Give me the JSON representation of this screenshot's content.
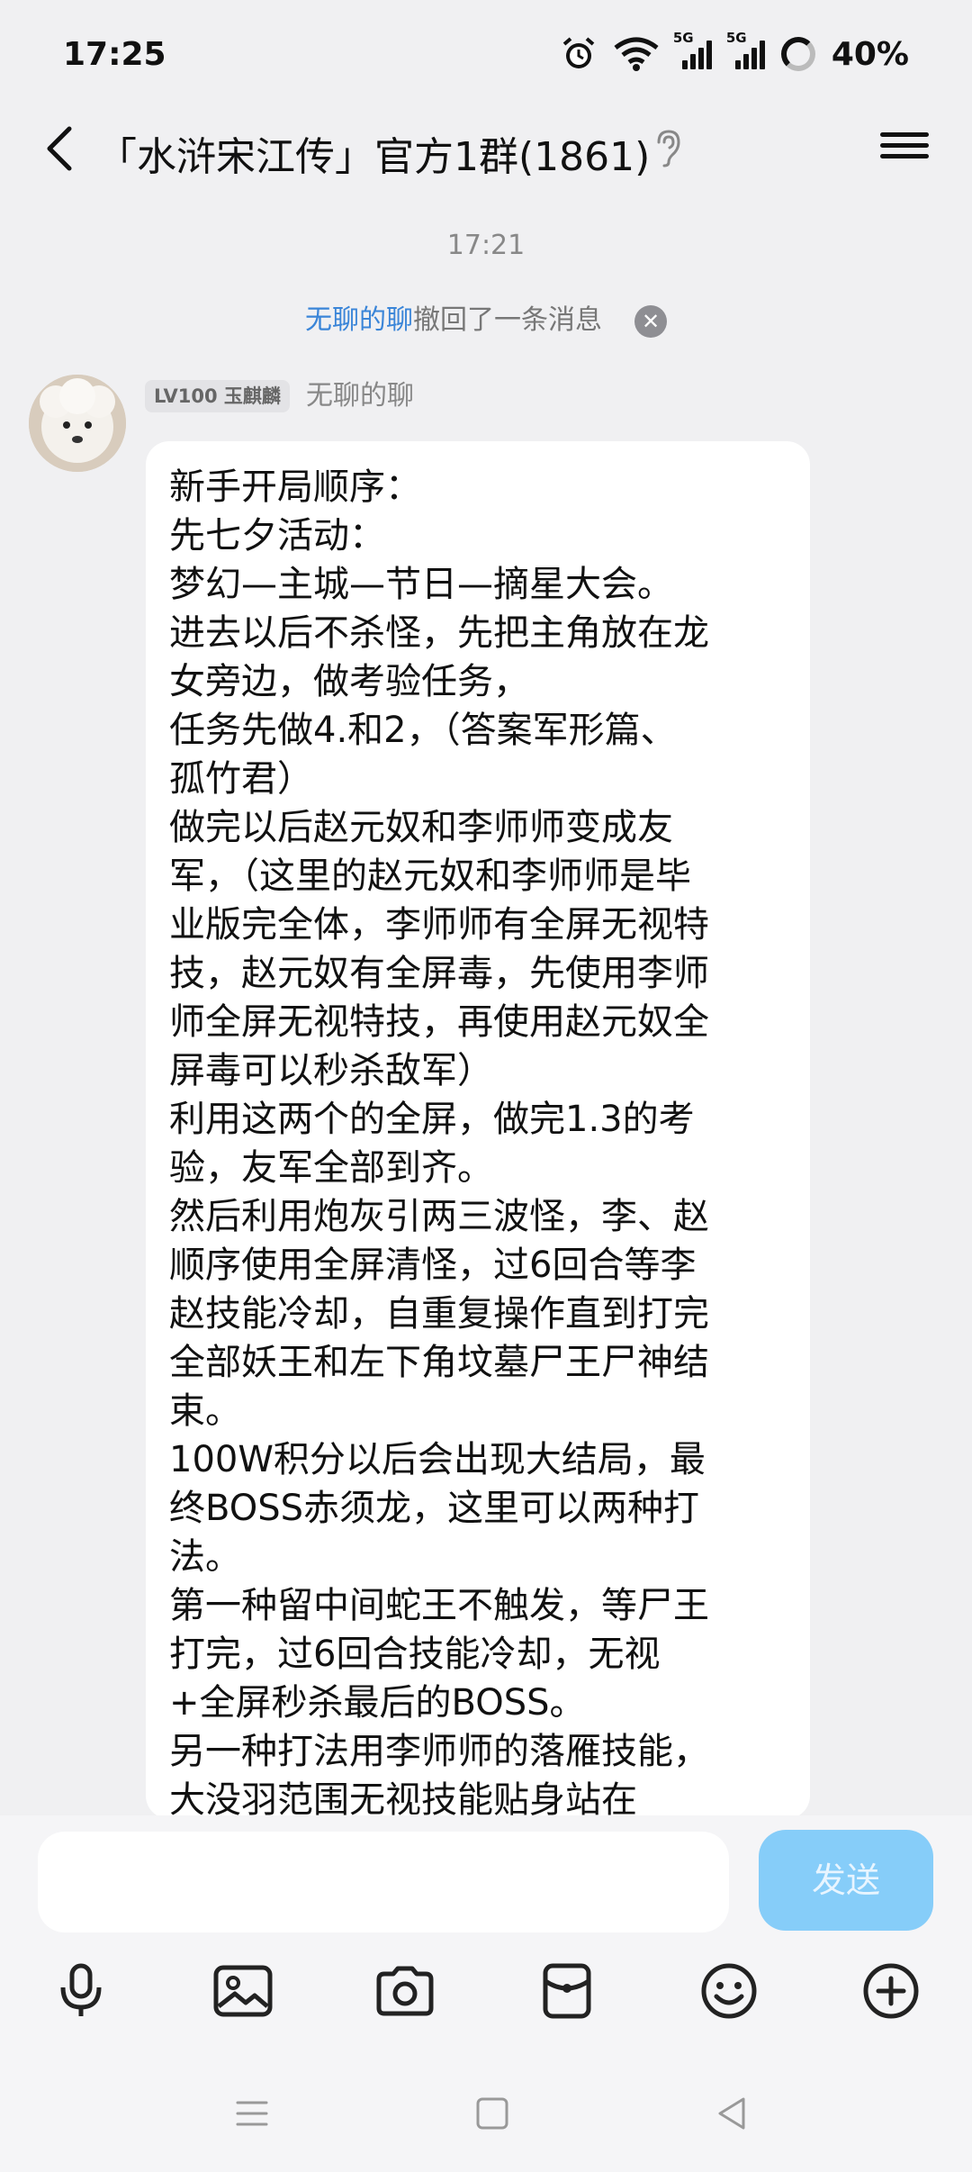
{
  "status_bar": {
    "time": "17:25",
    "network_1": "5G",
    "network_2": "5G",
    "battery": "40%",
    "icons": [
      "alarm-icon",
      "wifi-icon",
      "signal-icon",
      "signal-icon",
      "battery-icon"
    ]
  },
  "header": {
    "title": "「水浒宋江传」官方1群(1861)",
    "icons": [
      "back-icon",
      "ear-icon",
      "menu-icon"
    ]
  },
  "messages": {
    "timestamp": "17:21",
    "recall_notice": {
      "name": "无聊的聊",
      "text": "撤回了一条消息"
    },
    "message": {
      "level_badge": "LV100 玉麒麟",
      "sender": "无聊的聊",
      "lines": [
        "新手开局顺序：",
        "先七夕活动：",
        "梦幻—主城—节日—摘星大会。",
        "进去以后不杀怪，先把主角放在龙",
        "女旁边，做考验任务，",
        "任务先做4.和2，（答案军形篇、",
        "孤竹君）",
        "做完以后赵元奴和李师师变成友",
        "军，（这里的赵元奴和李师师是毕",
        "业版完全体，李师师有全屏无视特",
        "技，赵元奴有全屏毒，先使用李师",
        "师全屏无视特技，再使用赵元奴全",
        "屏毒可以秒杀敌军）",
        "利用这两个的全屏，做完1.3的考",
        "验，友军全部到齐。",
        "然后利用炮灰引两三波怪，李、赵",
        "顺序使用全屏清怪，过6回合等李",
        "赵技能冷却，自重复操作直到打完",
        "全部妖王和左下角坟墓尸王尸神结",
        "束。",
        "100W积分以后会出现大结局，最",
        "终BOSS赤须龙，这里可以两种打",
        "法。",
        "第一种留中间蛇王不触发，等尸王",
        "打完，过6回合技能冷却，无视",
        "+全屏秒杀最后的BOSS。",
        "另一种打法用李师师的落雁技能，",
        "大没羽范围无视技能贴身站在"
      ]
    }
  },
  "input": {
    "value": "",
    "send_label": "发送",
    "toolbar_icons": [
      "microphone-icon",
      "image-icon",
      "camera-icon",
      "red-packet-icon",
      "emoji-icon",
      "add-icon"
    ]
  },
  "nav_bar": {
    "icons": [
      "menu-nav-icon",
      "home-nav-icon",
      "back-nav-icon"
    ]
  },
  "colors": {
    "background": "#f0f0f2",
    "link_blue": "#3a85d8",
    "send_button": "#86cdf9"
  }
}
